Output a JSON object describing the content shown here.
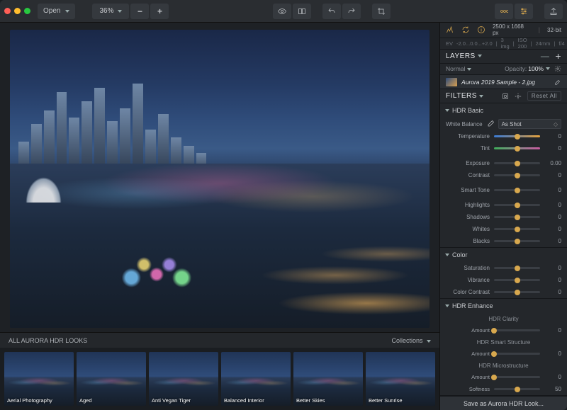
{
  "toolbar": {
    "open_label": "Open",
    "zoom_value": "36%",
    "zoom_out": "−",
    "zoom_in": "+"
  },
  "info": {
    "dimensions": "2500 x 1668 px",
    "depth": "32-bit",
    "ev_prefix": "EV",
    "ev_values": "-2.0...0.0...+2.0",
    "image_count": "3 img",
    "iso": "ISO 200",
    "focal": "24mm",
    "aperture": "f/4"
  },
  "layers": {
    "title": "LAYERS",
    "blend_label": "Normal",
    "opacity_label": "Opacity:",
    "opacity_value": "100%",
    "items": [
      {
        "name": "Aurora 2019 Sample - 2.jpg"
      }
    ]
  },
  "filters": {
    "title": "FILTERS",
    "reset_all": "Reset All",
    "sections": {
      "hdr_basic": {
        "title": "HDR Basic",
        "white_balance_label": "White Balance",
        "white_balance_value": "As Shot",
        "sliders": [
          {
            "label": "Temperature",
            "value": "0",
            "track": "temp",
            "pos": 50
          },
          {
            "label": "Tint",
            "value": "0",
            "track": "tint",
            "pos": 50
          },
          {
            "label": "Exposure",
            "value": "0.00",
            "track": "neutral",
            "pos": 50
          },
          {
            "label": "Contrast",
            "value": "0",
            "track": "neutral",
            "pos": 50
          },
          {
            "label": "Smart Tone",
            "value": "0",
            "track": "neutral",
            "pos": 50
          },
          {
            "label": "Highlights",
            "value": "0",
            "track": "neutral",
            "pos": 50
          },
          {
            "label": "Shadows",
            "value": "0",
            "track": "neutral",
            "pos": 50
          },
          {
            "label": "Whites",
            "value": "0",
            "track": "neutral",
            "pos": 50
          },
          {
            "label": "Blacks",
            "value": "0",
            "track": "neutral",
            "pos": 50
          }
        ]
      },
      "color": {
        "title": "Color",
        "sliders": [
          {
            "label": "Saturation",
            "value": "0",
            "pos": 50
          },
          {
            "label": "Vibrance",
            "value": "0",
            "pos": 50
          },
          {
            "label": "Color Contrast",
            "value": "0",
            "pos": 50
          }
        ]
      },
      "hdr_enhance": {
        "title": "HDR Enhance",
        "groups": [
          {
            "subtitle": "HDR Clarity",
            "sliders": [
              {
                "label": "Amount",
                "value": "0",
                "pos": 0
              }
            ]
          },
          {
            "subtitle": "HDR Smart Structure",
            "sliders": [
              {
                "label": "Amount",
                "value": "0",
                "pos": 0
              }
            ]
          },
          {
            "subtitle": "HDR Microstructure",
            "sliders": [
              {
                "label": "Amount",
                "value": "0",
                "pos": 0
              },
              {
                "label": "Softness",
                "value": "50",
                "pos": 50
              }
            ]
          }
        ]
      }
    }
  },
  "looks": {
    "header": "ALL AURORA HDR LOOKS",
    "collections_label": "Collections",
    "thumbs": [
      {
        "label": "Aerial Photography"
      },
      {
        "label": "Aged"
      },
      {
        "label": "Anti Vegan Tiger"
      },
      {
        "label": "Balanced Interior"
      },
      {
        "label": "Better Skies"
      },
      {
        "label": "Better Sunrise"
      }
    ]
  },
  "footer": {
    "save_look": "Save as Aurora HDR Look..."
  }
}
